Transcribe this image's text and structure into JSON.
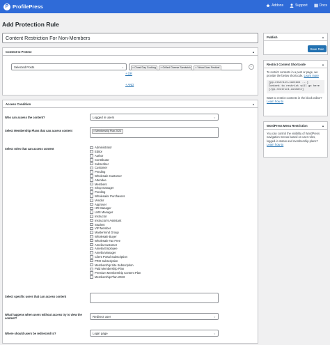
{
  "topbar": {
    "brand": "ProfilePress",
    "logo_glyph": "P",
    "nav": [
      {
        "label": "Addons",
        "icon": "star-icon"
      },
      {
        "label": "Support",
        "icon": "person-icon"
      },
      {
        "label": "Docs",
        "icon": "book-icon"
      }
    ]
  },
  "page": {
    "title": "Add Protection Rule",
    "rule_title_value": "Content Restriction For Non-Members"
  },
  "content_to_protect": {
    "header": "Content to Protect",
    "toggle": "▲",
    "type_selected": "Selected Posts",
    "tags": [
      "Chest Day Cocking",
      "Grilled Cheese Sandwich",
      "Virtual Jazz Festival"
    ],
    "or_link": "+ OR",
    "and_link": "+ AND",
    "remove_glyph": "−"
  },
  "access_condition": {
    "header": "Access Condition",
    "toggle": "▲",
    "who_label": "Who can access the content?",
    "who_value": "Logged in users",
    "plans_label": "Select Membership Plans that can access content",
    "plans_tags": [
      "Membership Plan 2023"
    ],
    "roles_label": "Select roles that can access content",
    "roles": [
      "Administrator",
      "Editor",
      "Author",
      "Contributor",
      "Subscriber",
      "Customer",
      "Pending",
      "Wholesale Customer",
      "Attendee",
      "Members",
      "Shop manager",
      "Pending",
      "Wholesaler Purchasers",
      "Vendor",
      "Approver",
      "HR Manager",
      "LMS Manager",
      "Instructor",
      "Instructor's Assistant",
      "Student",
      "VIP Member",
      "Mastermind Group",
      "Wholesale Buyer",
      "Wholesale Tax Free",
      "Amelia Customer",
      "Amelia Employee",
      "Amelia Manager",
      "Client Portal Subscription",
      "PRO Subscription",
      "Membership Site Subscription",
      "Paid Membership Plan",
      "Premium Membership Content Plan",
      "Membership Plan 2023"
    ],
    "users_label": "Select specific users that can access content",
    "users_value": "",
    "noaccess_label": "What happens when users without access try to view the content?",
    "noaccess_value": "Redirect user",
    "redirect_label": "Where should users be redirected to?",
    "redirect_value": "Login page"
  },
  "publish": {
    "header": "Publish",
    "toggle": "▲",
    "save_label": "Save Rule"
  },
  "shortcode": {
    "header": "Restrict Content Shortcode",
    "toggle": "▲",
    "intro": "To restrict contents in a post or page, we provide the below shortcode.",
    "learn_more": "Learn more",
    "code": [
      "[pp-restrict-content ...]",
      "Content to restrict will go here",
      "[/pp-restrict-content]"
    ],
    "block_text": "Want to restrict contents in the block editor?",
    "block_link": "Learn how to"
  },
  "menu_restriction": {
    "header": "WordPress Menu Restriction",
    "toggle": "▲",
    "text": "You can control the visibility of WordPress navigation menus based on user roles, logged-in status and membership plans?",
    "link": "Learn how to"
  }
}
